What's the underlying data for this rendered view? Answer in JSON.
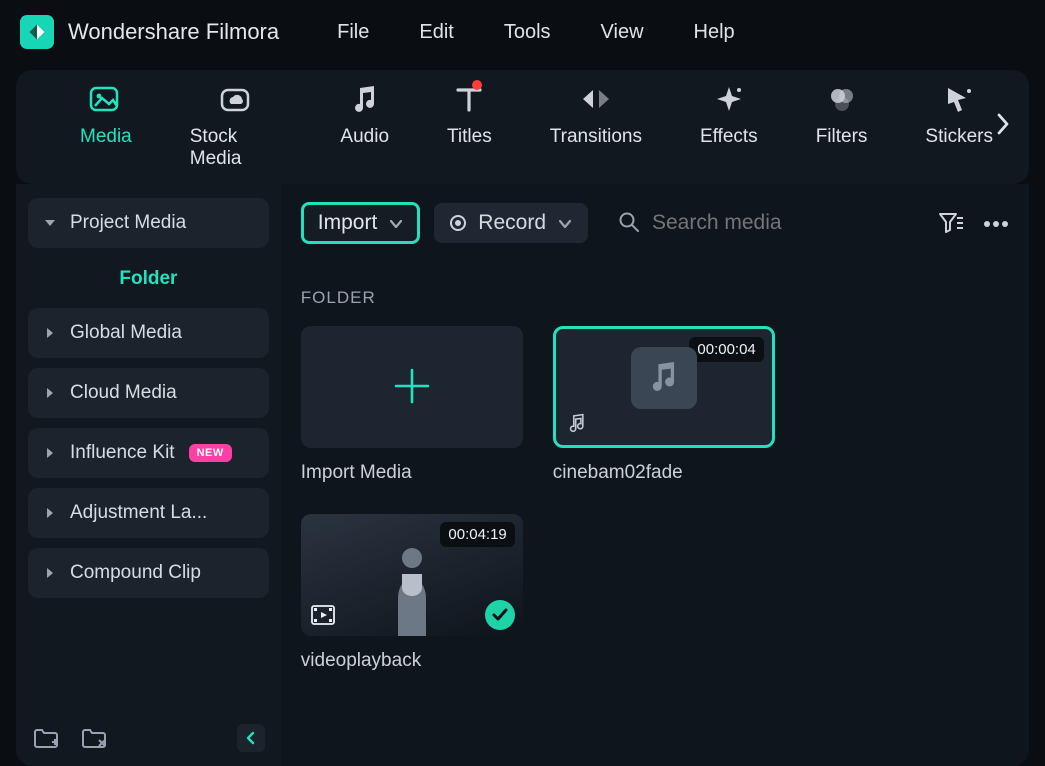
{
  "app": {
    "title": "Wondershare Filmora"
  },
  "menu": {
    "file": "File",
    "edit": "Edit",
    "tools": "Tools",
    "view": "View",
    "help": "Help"
  },
  "ribbon": {
    "media": "Media",
    "stock_media": "Stock Media",
    "audio": "Audio",
    "titles": "Titles",
    "transitions": "Transitions",
    "effects": "Effects",
    "filters": "Filters",
    "stickers": "Stickers"
  },
  "sidebar": {
    "project_media": "Project Media",
    "folder": "Folder",
    "global_media": "Global Media",
    "cloud_media": "Cloud Media",
    "influence_kit": "Influence Kit",
    "influence_kit_badge": "NEW",
    "adjustment_layer": "Adjustment La...",
    "compound_clip": "Compound Clip"
  },
  "toolbar": {
    "import": "Import",
    "record": "Record",
    "search_placeholder": "Search media"
  },
  "content": {
    "section": "FOLDER",
    "import_tile": "Import Media",
    "clips": [
      {
        "name": "cinebam02fade",
        "duration": "00:00:04",
        "kind": "audio",
        "selected": true,
        "used": false
      },
      {
        "name": "videoplayback",
        "duration": "00:04:19",
        "kind": "video",
        "selected": false,
        "used": true
      }
    ]
  }
}
